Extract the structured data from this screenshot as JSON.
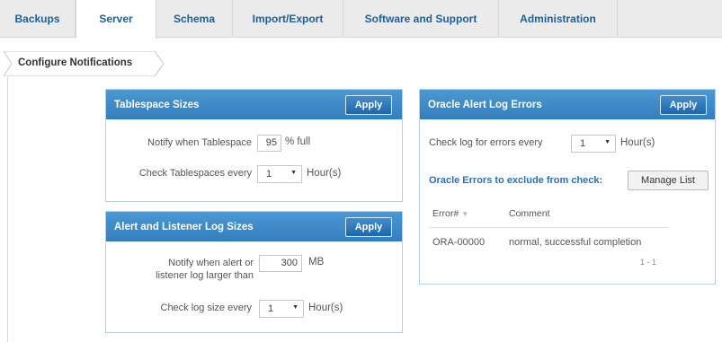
{
  "tabs": [
    {
      "label": "Backups",
      "active": false
    },
    {
      "label": "Server",
      "active": true
    },
    {
      "label": "Schema",
      "active": false
    },
    {
      "label": "Import/Export",
      "active": false
    },
    {
      "label": "Software and Support",
      "active": false
    },
    {
      "label": "Administration",
      "active": false
    }
  ],
  "breadcrumb": {
    "label": "Configure Notifications"
  },
  "apply_label": "Apply",
  "tablespace": {
    "title": "Tablespace Sizes",
    "notify_label": "Notify when Tablespace",
    "notify_value": "95",
    "notify_unit": "% full",
    "check_label": "Check Tablespaces every",
    "check_value": "1",
    "check_unit": "Hour(s)"
  },
  "alert_log": {
    "title": "Alert and Listener Log Sizes",
    "notify_label_line1": "Notify when alert or",
    "notify_label_line2": "listener log larger than",
    "notify_value": "300",
    "notify_unit": "MB",
    "check_label": "Check log size every",
    "check_value": "1",
    "check_unit": "Hour(s)"
  },
  "oracle_errors": {
    "title": "Oracle Alert Log Errors",
    "check_label": "Check log for errors every",
    "check_value": "1",
    "check_unit": "Hour(s)",
    "exclude_label": "Oracle Errors to exclude from check:",
    "manage_label": "Manage List",
    "columns": [
      "Error#",
      "Comment"
    ],
    "rows": [
      {
        "error": "ORA-00000",
        "comment": "normal, successful completion"
      }
    ],
    "pager": "1 - 1"
  },
  "colors": {
    "panel_header": "#357ebd",
    "tab_text": "#1d5f99",
    "link": "#2a6fb7"
  }
}
